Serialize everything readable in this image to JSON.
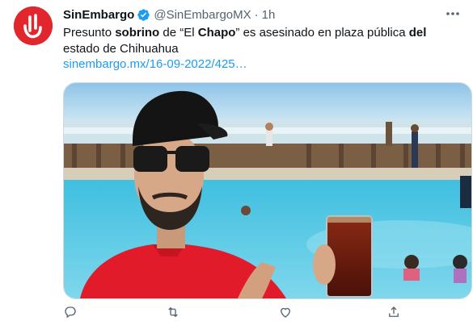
{
  "tweet": {
    "author_name": "SinEmbargo",
    "handle": "@SinEmbargoMX",
    "separator": "·",
    "time": "1h",
    "text_parts": {
      "p1": "Presunto ",
      "b1": "sobrino",
      "p2": " de “El ",
      "b2": "Chapo",
      "p3": "” es asesinado en plaza pública ",
      "b3": "del",
      "p4": " estado de Chihuahua"
    },
    "link": "sinembargo.mx/16-09-2022/425…"
  },
  "actions": {
    "reply_icon": "reply-icon",
    "retweet_icon": "retweet-icon",
    "like_icon": "like-icon",
    "share_icon": "share-icon"
  },
  "colors": {
    "brand": "#e1262d",
    "link": "#1d9bf0",
    "verified": "#1d9bf0",
    "secondary_text": "#536471"
  }
}
